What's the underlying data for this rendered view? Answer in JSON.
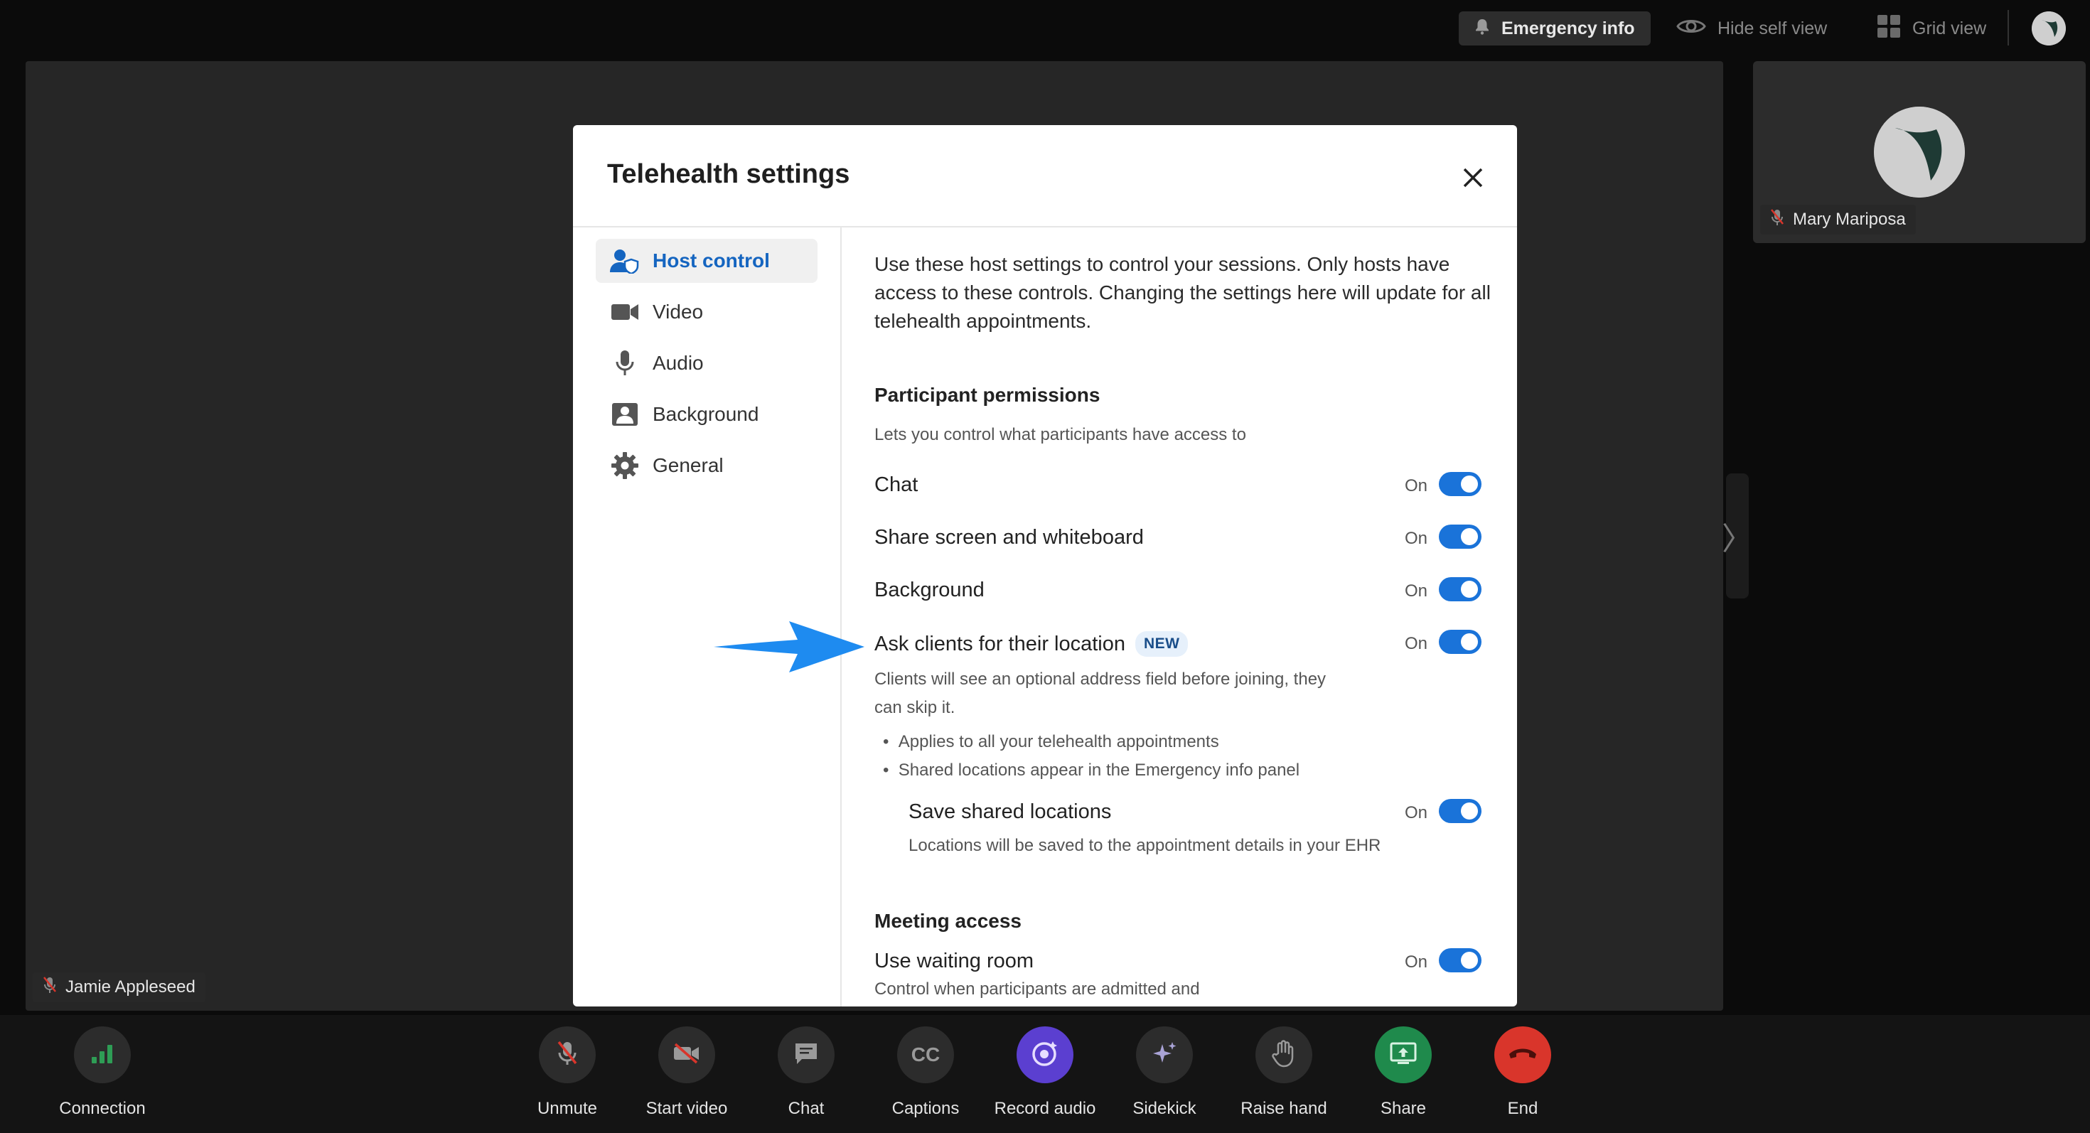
{
  "topbar": {
    "emergency_label": "Emergency info",
    "hide_self_view_label": "Hide self view",
    "grid_view_label": "Grid view"
  },
  "participants": {
    "remote_name": "Mary Mariposa",
    "local_name": "Jamie Appleseed"
  },
  "modal": {
    "title": "Telehealth settings",
    "nav": [
      {
        "label": "Host control",
        "icon": "host-control-icon",
        "active": true
      },
      {
        "label": "Video",
        "icon": "video-icon"
      },
      {
        "label": "Audio",
        "icon": "microphone-icon"
      },
      {
        "label": "Background",
        "icon": "background-icon"
      },
      {
        "label": "General",
        "icon": "gear-icon"
      }
    ],
    "intro": "Use these host settings to control your sessions. Only hosts have access to these controls. Changing the settings here will update for all telehealth appointments.",
    "participant_permissions": {
      "heading": "Participant permissions",
      "subtitle": "Lets you control what participants have access to",
      "rows": [
        {
          "label": "Chat",
          "state": "On"
        },
        {
          "label": "Share screen and whiteboard",
          "state": "On"
        },
        {
          "label": "Background",
          "state": "On"
        }
      ],
      "location": {
        "label": "Ask clients for their location",
        "badge": "NEW",
        "state": "On",
        "desc_line1": "Clients will see an optional address field before joining, they",
        "desc_line2": "can skip it.",
        "bullets": [
          "Applies to all your telehealth appointments",
          "Shared locations appear in the Emergency info panel"
        ],
        "save": {
          "label": "Save shared locations",
          "state": "On",
          "desc": "Locations will be saved to the appointment details in your EHR"
        }
      }
    },
    "meeting_access": {
      "heading": "Meeting access",
      "waiting_room": {
        "label": "Use waiting room",
        "state": "On",
        "desc": "Control when participants are admitted and"
      }
    }
  },
  "controls": [
    {
      "label": "Connection"
    },
    {
      "label": "Unmute"
    },
    {
      "label": "Start video"
    },
    {
      "label": "Chat"
    },
    {
      "label": "Captions",
      "glyph": "CC"
    },
    {
      "label": "Record audio"
    },
    {
      "label": "Sidekick"
    },
    {
      "label": "Raise hand"
    },
    {
      "label": "Share"
    },
    {
      "label": "End"
    }
  ],
  "colors": {
    "accent": "#1a73d9",
    "record": "#5b3fd0",
    "share": "#1f8a4c",
    "end": "#d9352b",
    "connection": "#2e9d55"
  }
}
